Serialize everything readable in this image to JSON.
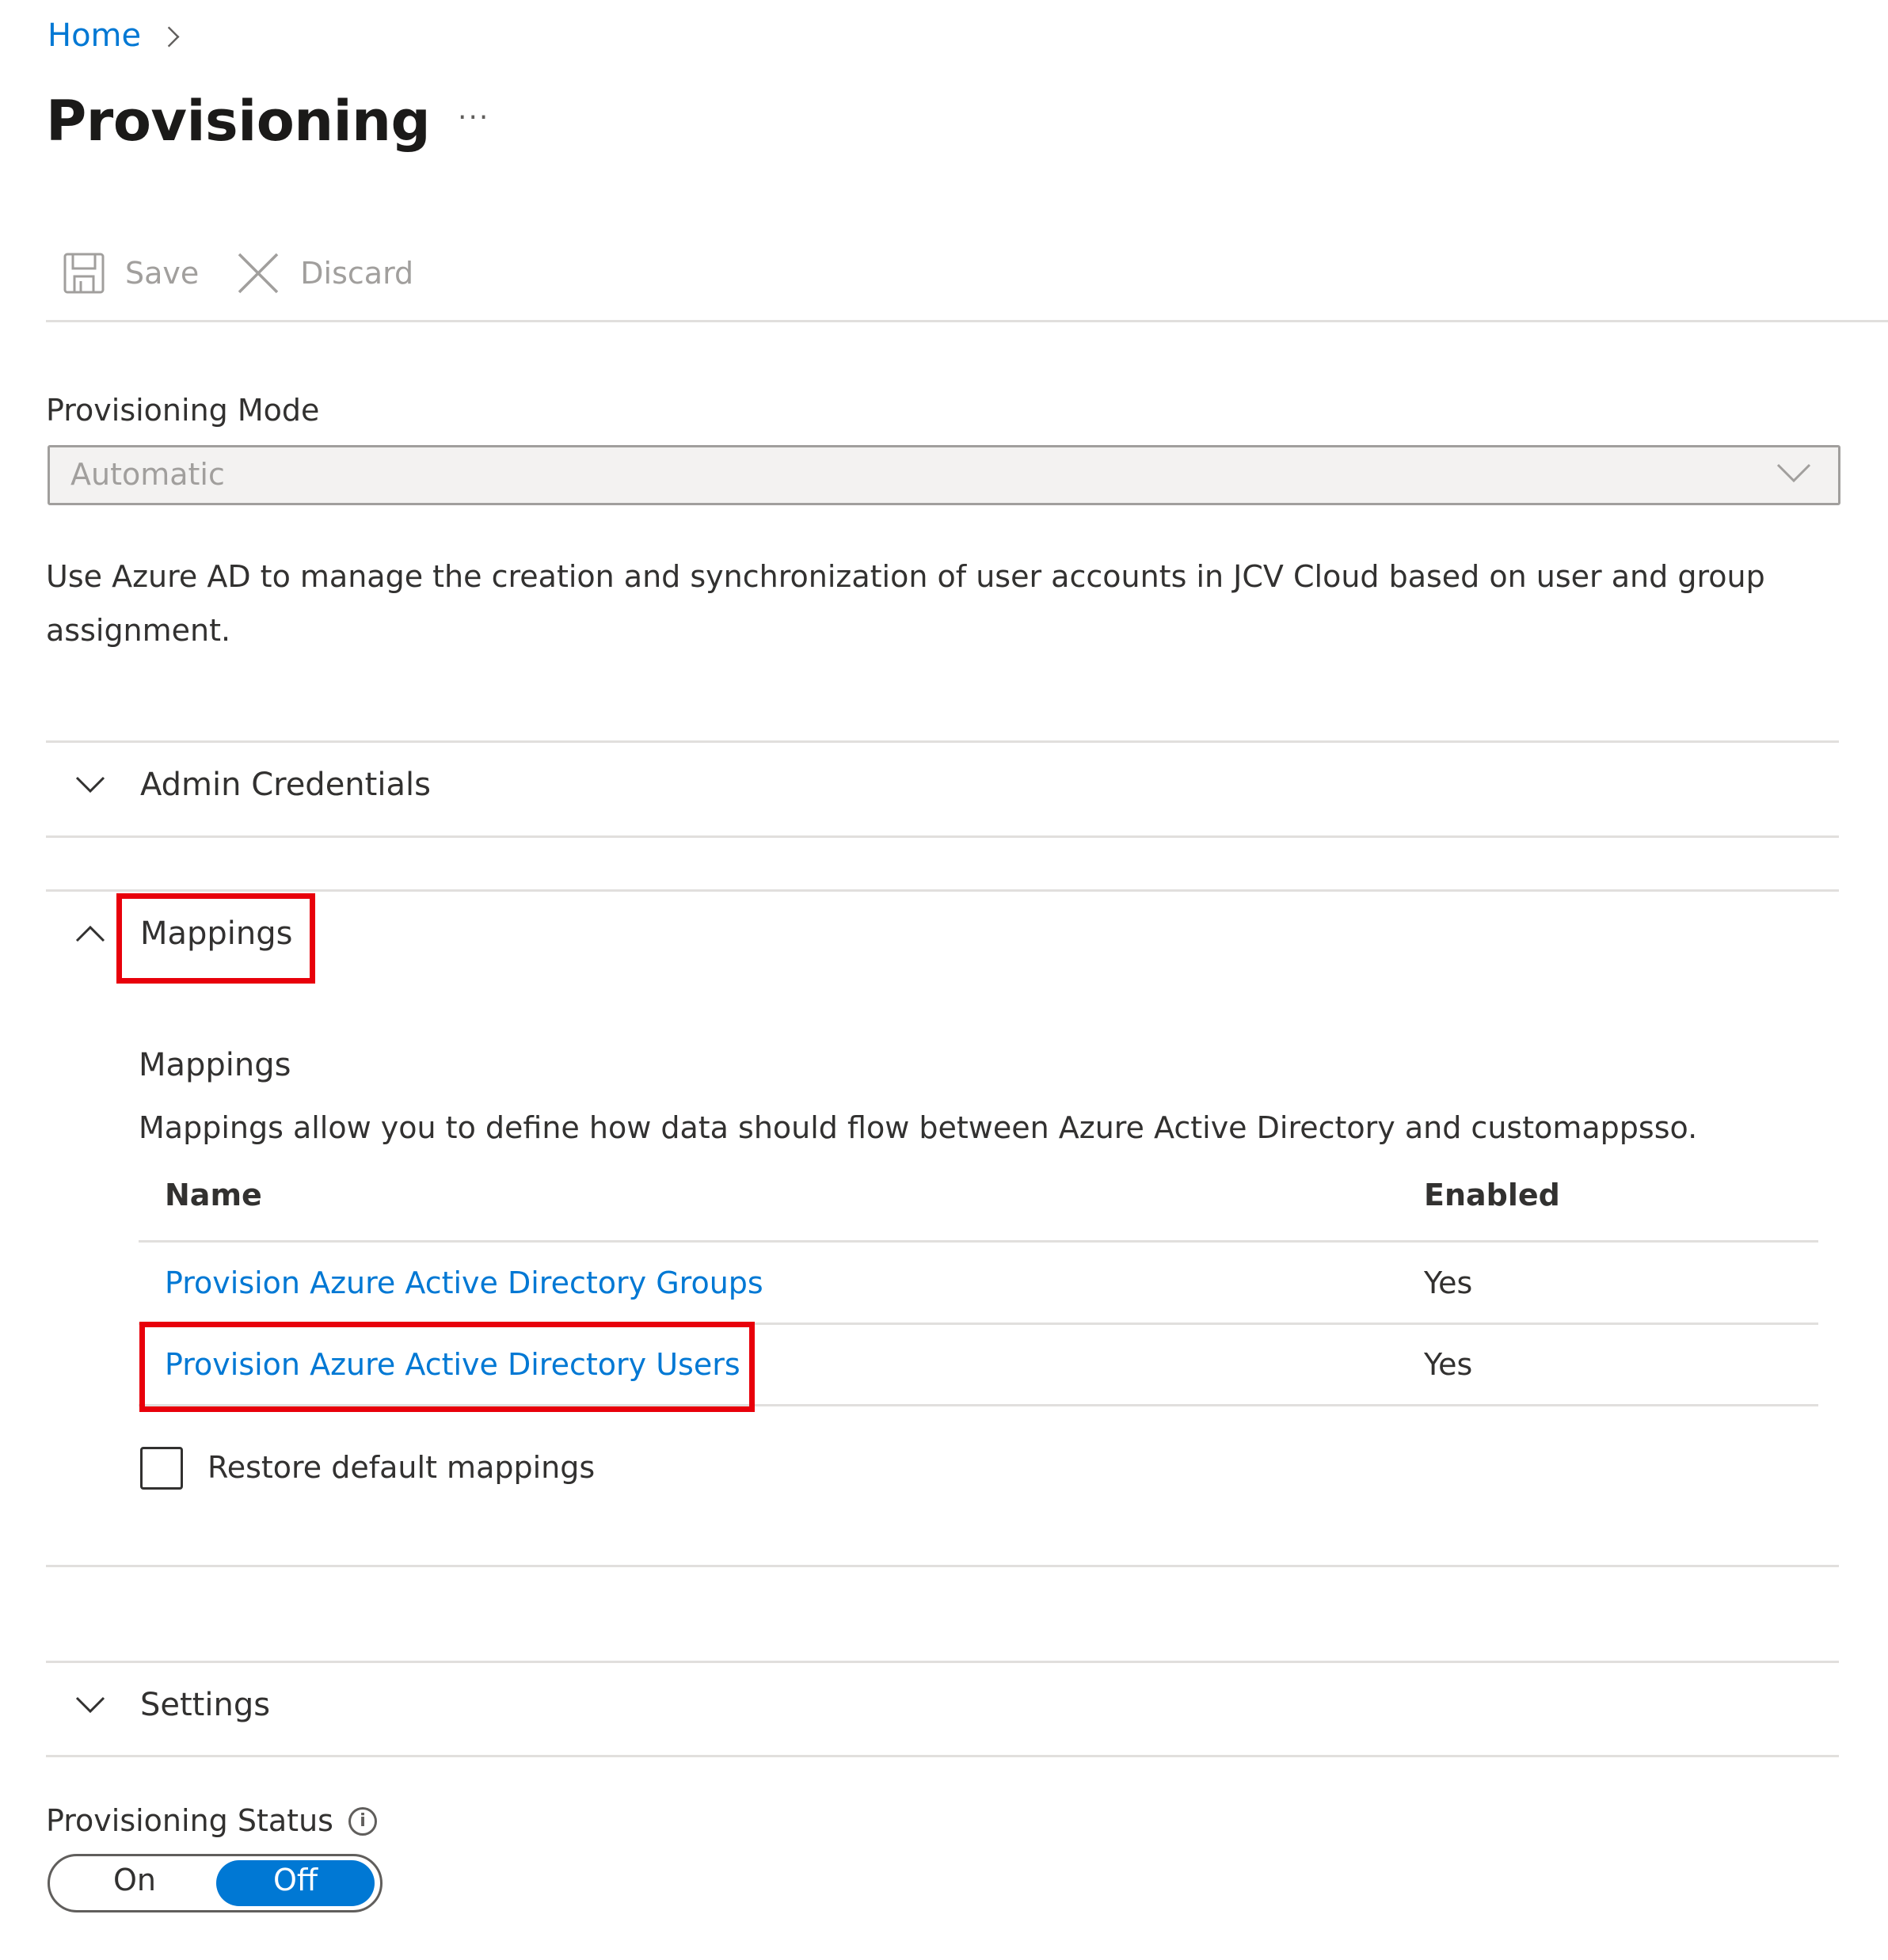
{
  "breadcrumb": {
    "home": "Home"
  },
  "header": {
    "title": "Provisioning",
    "more": "···"
  },
  "toolbar": {
    "save_label": "Save",
    "discard_label": "Discard"
  },
  "provisioning_mode": {
    "label": "Provisioning Mode",
    "value": "Automatic",
    "description": "Use Azure AD to manage the creation and synchronization of user accounts in JCV Cloud based on user and group assignment."
  },
  "sections": {
    "admin_credentials": {
      "label": "Admin Credentials",
      "expanded": false
    },
    "mappings": {
      "label": "Mappings",
      "expanded": true,
      "title": "Mappings",
      "description": "Mappings allow you to define how data should flow between Azure Active Directory and customappsso.",
      "columns": [
        "Name",
        "Enabled"
      ],
      "rows": [
        {
          "name": "Provision Azure Active Directory Groups",
          "enabled": "Yes"
        },
        {
          "name": "Provision Azure Active Directory Users",
          "enabled": "Yes"
        }
      ],
      "restore_label": "Restore default mappings",
      "restore_checked": false
    },
    "settings": {
      "label": "Settings",
      "expanded": false
    }
  },
  "provisioning_status": {
    "label": "Provisioning Status",
    "on_label": "On",
    "off_label": "Off",
    "selected": "Off"
  },
  "colors": {
    "accent": "#0078d4",
    "highlight": "#e8000b",
    "divider": "#e1dfdd"
  }
}
